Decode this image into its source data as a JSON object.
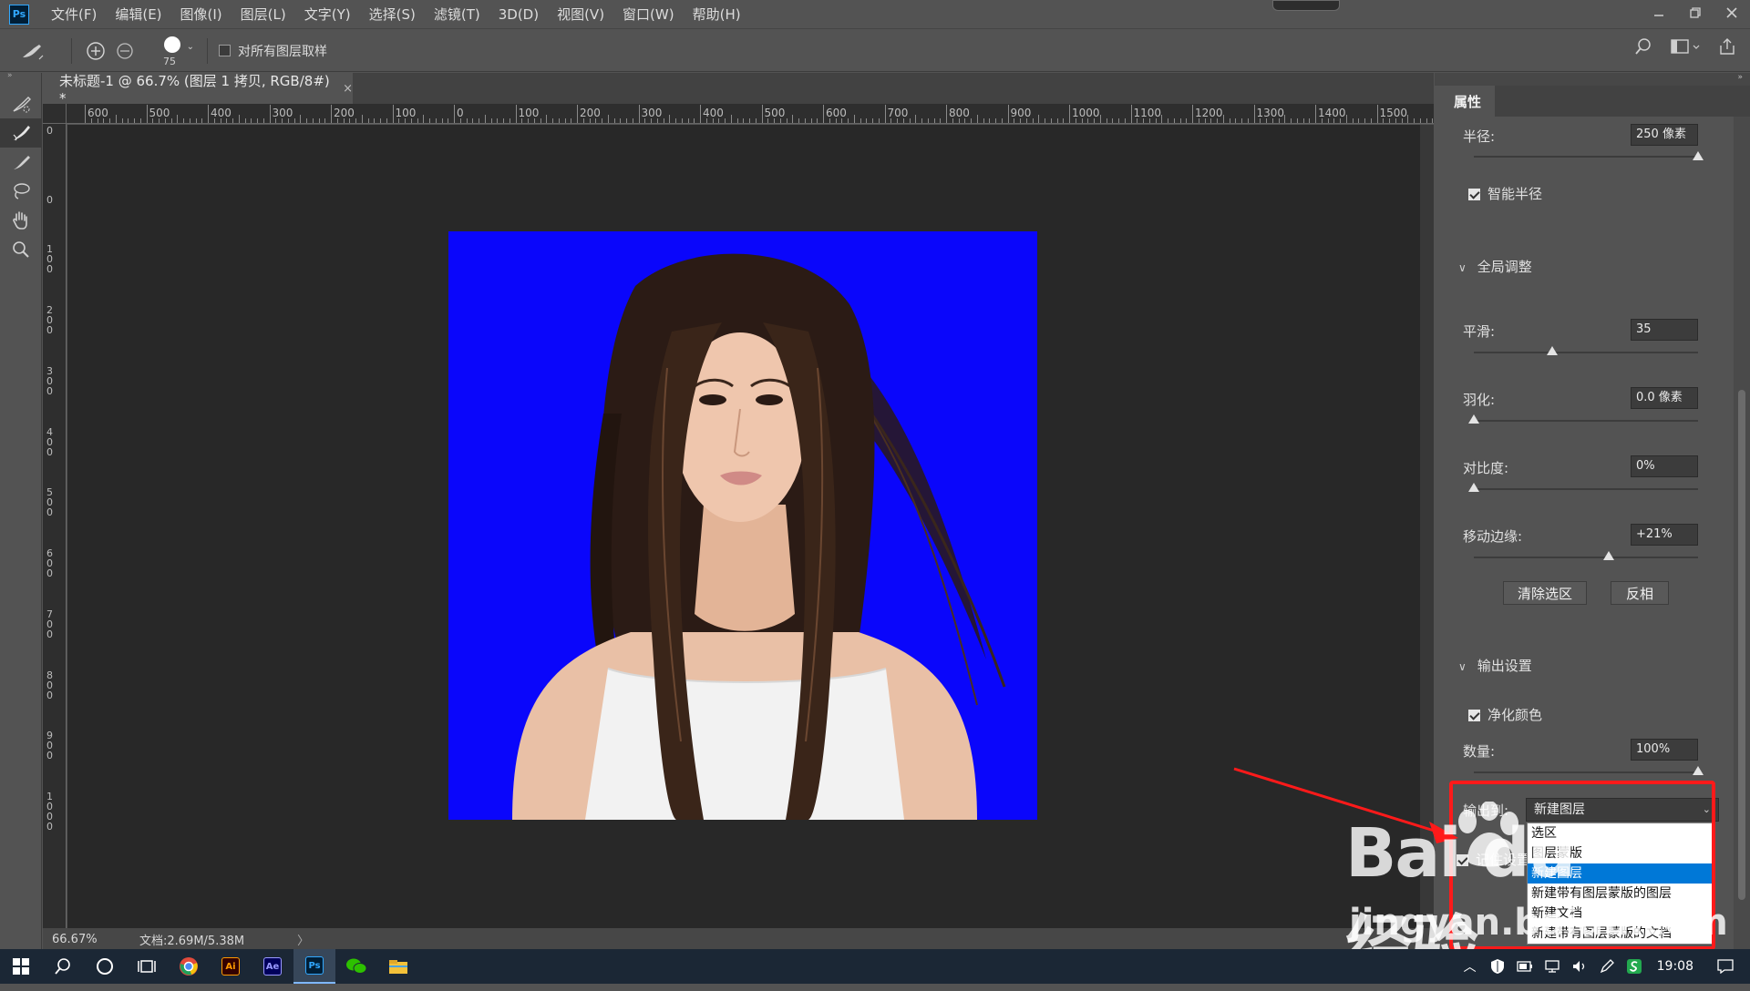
{
  "app": {
    "logo": "Ps",
    "menus": [
      "文件(F)",
      "编辑(E)",
      "图像(I)",
      "图层(L)",
      "文字(Y)",
      "选择(S)",
      "滤镜(T)",
      "3D(D)",
      "视图(V)",
      "窗口(W)",
      "帮助(H)"
    ]
  },
  "options": {
    "brush_size": "75",
    "sample_all_label": "对所有图层取样"
  },
  "document": {
    "tab_title": "未标题-1 @ 66.7% (图层 1 拷贝, RGB/8#) *",
    "close_glyph": "×",
    "ruler_h": [
      "600",
      "500",
      "400",
      "300",
      "200",
      "100",
      "0",
      "100",
      "200",
      "300",
      "400",
      "500",
      "600",
      "700",
      "800",
      "900",
      "1000",
      "1100",
      "1200",
      "1300",
      "1400",
      "1500"
    ],
    "ruler_v": [
      "0",
      "0",
      "100",
      "200",
      "300",
      "400",
      "500",
      "600",
      "700",
      "800",
      "900",
      "1000"
    ],
    "zoom": "66.67%",
    "doc_info": "文档:2.69M/5.38M",
    "status_arrow": "〉"
  },
  "colors": {
    "photo_bg": "#0a06fb",
    "highlight_red": "#ff1a1a",
    "selection_blue": "#0078d7"
  },
  "properties": {
    "tab_label": "属性",
    "radius_label": "半径:",
    "radius_value": "250 像素",
    "smart_radius_label": "智能半径",
    "global_section": "全局调整",
    "smooth_label": "平滑:",
    "smooth_value": "35",
    "feather_label": "羽化:",
    "feather_value": "0.0 像素",
    "contrast_label": "对比度:",
    "contrast_value": "0%",
    "shift_label": "移动边缘:",
    "shift_value": "+21%",
    "clear_btn": "清除选区",
    "invert_btn": "反相",
    "output_section": "输出设置",
    "decontam_label": "净化颜色",
    "amount_label": "数量:",
    "amount_value": "100%",
    "output_to_label": "输出到:",
    "output_to_value": "新建图层",
    "remember_label": "记住设置",
    "output_options": [
      "选区",
      "图层蒙版",
      "新建图层",
      "新建带有图层蒙版的图层",
      "新建文档",
      "新建带有图层蒙版的文档"
    ],
    "selected_option_index": 2
  },
  "sliders": {
    "radius": 1.0,
    "smooth": 0.35,
    "feather": 0.0,
    "contrast": 0.0,
    "shift": 0.6,
    "amount": 1.0
  },
  "watermark": {
    "main": "Bai du 经验",
    "sub": "jingyan.baidu.com"
  },
  "taskbar": {
    "time": "19:08",
    "apps": [
      "Ai",
      "Ae",
      "Ps"
    ]
  }
}
